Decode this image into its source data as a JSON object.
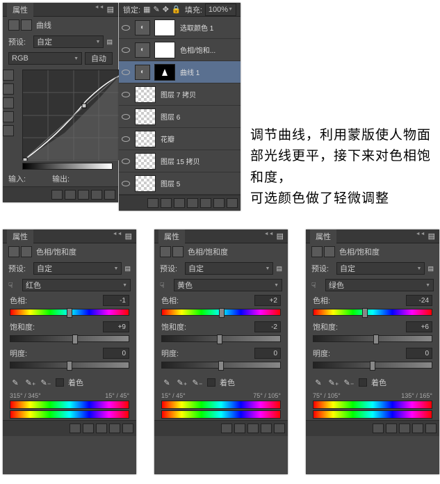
{
  "curves": {
    "title": "属性",
    "adj_name": "曲线",
    "preset_label": "预设:",
    "preset_value": "自定",
    "channel": "RGB",
    "auto": "自动",
    "input_label": "输入:",
    "output_label": "输出:"
  },
  "layers": {
    "header_label": "锁定:",
    "fill_label": "填充:",
    "fill_value": "100%",
    "items": [
      {
        "name": "选取颜色 1",
        "type": "adj",
        "mask": "white"
      },
      {
        "name": "色相/饱和...",
        "type": "adj",
        "mask": "white"
      },
      {
        "name": "曲线 1",
        "type": "adj",
        "mask": "black",
        "selected": true
      },
      {
        "name": "图层 7 拷贝",
        "type": "img",
        "mask": "checker"
      },
      {
        "name": "图层 6",
        "type": "img",
        "mask": "checker"
      },
      {
        "name": "花瓣",
        "type": "img",
        "mask": "checker"
      },
      {
        "name": "图层 15 拷贝",
        "type": "img",
        "mask": "checker"
      },
      {
        "name": "图层 5",
        "type": "img",
        "mask": "checker"
      }
    ]
  },
  "annotation": "调节曲线，利用蒙版使人物面部光线更平，接下来对色相饱和度，\n可选颜色做了轻微调整",
  "hue": {
    "title": "属性",
    "adj_name": "色相/饱和度",
    "preset_label": "预设:",
    "preset_value": "自定",
    "hue_label": "色相:",
    "sat_label": "饱和度:",
    "light_label": "明度:",
    "colorize": "着色",
    "panels": [
      {
        "channel": "红色",
        "hue": -1,
        "sat": 9,
        "light": 0,
        "range_left": "315° / 345°",
        "range_right": "15° / 45°"
      },
      {
        "channel": "黄色",
        "hue": 2,
        "sat": -2,
        "light": 0,
        "range_left": "15° / 45°",
        "range_right": "75° / 105°"
      },
      {
        "channel": "绿色",
        "hue": -24,
        "sat": 6,
        "light": 0,
        "range_left": "75° / 105°",
        "range_right": "135° / 165°"
      }
    ]
  }
}
